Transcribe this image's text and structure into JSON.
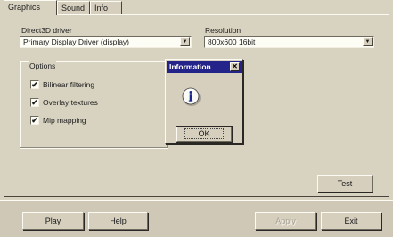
{
  "tabs": [
    {
      "label": "Graphics"
    },
    {
      "label": "Sound"
    },
    {
      "label": "Info"
    }
  ],
  "driver": {
    "label": "Direct3D driver",
    "value": "Primary Display Driver (display)"
  },
  "resolution": {
    "label": "Resolution",
    "value": "800x600 16bit"
  },
  "options": {
    "title": "Options",
    "items": [
      {
        "label": "Bilinear filtering",
        "checked": true
      },
      {
        "label": "Overlay textures",
        "checked": true
      },
      {
        "label": "Mip mapping",
        "checked": true
      }
    ]
  },
  "dialog": {
    "title": "Information",
    "close_glyph": "✕",
    "icon": "information-icon",
    "ok_label": "OK"
  },
  "buttons": {
    "test": "Test",
    "play": "Play",
    "help": "Help",
    "apply": "Apply",
    "exit": "Exit"
  },
  "glyphs": {
    "checkmark": "✔",
    "dropdown": "▼"
  },
  "colors": {
    "dialog_title_bar": "#23238a",
    "window_bg": "#d8d2c0"
  }
}
